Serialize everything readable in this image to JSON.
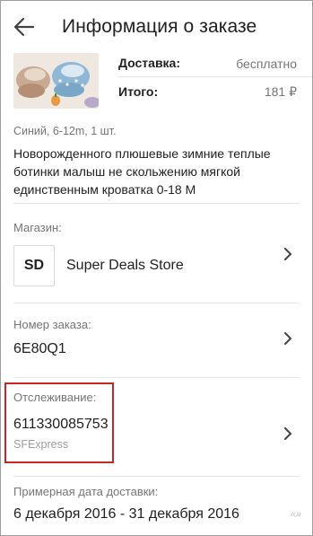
{
  "header": {
    "title": "Информация о заказе"
  },
  "product": {
    "shipping_label": "Доставка:",
    "shipping_value": "бесплатно",
    "total_label": "Итого:",
    "total_value": "181 ₽",
    "variant": "Синий, 6-12m, 1 шт.",
    "description": "Новорожденного плюшевые зимние теплые ботинки малыш не скольжению мягкой единственным кроватка 0-18 M"
  },
  "store": {
    "label": "Магазин:",
    "logo_text": "SD",
    "name": "Super Deals Store"
  },
  "order": {
    "label": "Номер заказа:",
    "number": "6E80Q1"
  },
  "tracking": {
    "label": "Отслеживание:",
    "number": "611330085753",
    "carrier": "SFExpress"
  },
  "delivery": {
    "label": "Примерная дата доставки:",
    "dates": "6 декабря 2016 - 31 декабря 2016"
  },
  "watermark": "«»",
  "colors": {
    "highlight": "#c62828",
    "secondary_text": "#757575",
    "divider": "#e6e6e6"
  },
  "icons": {
    "back": "arrow-left",
    "chevron": "chevron-right"
  }
}
